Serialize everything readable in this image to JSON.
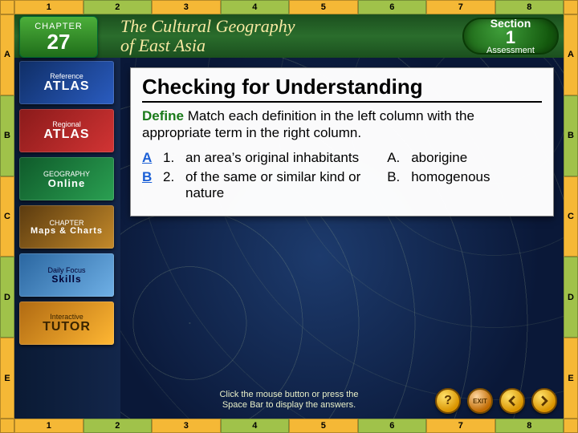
{
  "chapter": {
    "label": "CHAPTER",
    "number": "27"
  },
  "header": {
    "title_line1": "The Cultural Geography",
    "title_line2": "of East Asia"
  },
  "section_badge": {
    "line1": "Section",
    "number": "1",
    "line2": "Assessment"
  },
  "ruler": {
    "top": [
      "1",
      "2",
      "3",
      "4",
      "5",
      "6",
      "7",
      "8"
    ],
    "bottom": [
      "1",
      "2",
      "3",
      "4",
      "5",
      "6",
      "7",
      "8"
    ],
    "left": [
      "A",
      "B",
      "C",
      "D",
      "E"
    ],
    "right": [
      "A",
      "B",
      "C",
      "D",
      "E"
    ]
  },
  "sidebar": {
    "items": [
      {
        "small": "Reference",
        "big": "ATLAS"
      },
      {
        "small": "Regional",
        "big": "ATLAS"
      },
      {
        "small": "GEOGRAPHY",
        "big": "Online"
      },
      {
        "small": "CHAPTER",
        "big": "Maps & Charts"
      },
      {
        "small": "Daily Focus",
        "big": "Skills"
      },
      {
        "small": "Interactive",
        "big": "TUTOR"
      }
    ]
  },
  "content": {
    "title": "Checking for Understanding",
    "keyword": "Define",
    "instruction_rest": "Match each definition in the left column with the appropriate term in the right column.",
    "questions": [
      {
        "answer": "A",
        "num": "1.",
        "text": "an area’s original inhabitants"
      },
      {
        "answer": "B",
        "num": "2.",
        "text": "of the same or similar kind or nature"
      }
    ],
    "terms": [
      {
        "label": "A.",
        "word": "aborigine"
      },
      {
        "label": "B.",
        "word": "homogenous"
      }
    ]
  },
  "hint": {
    "line1": "Click the mouse button or press the",
    "line2": "Space Bar to display the answers."
  },
  "nav": {
    "help": "?",
    "exit": "EXIT"
  }
}
